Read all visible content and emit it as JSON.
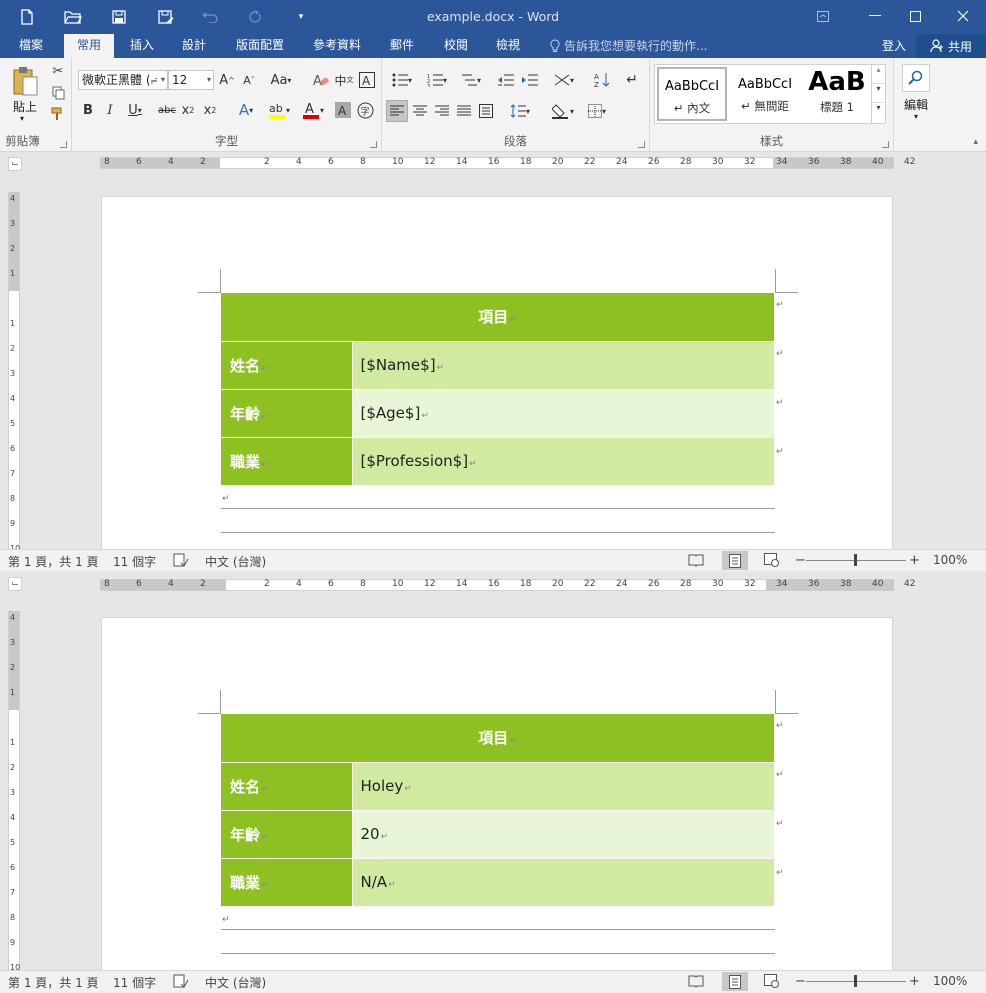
{
  "window": {
    "title": "example.docx - Word",
    "controls": [
      "ribbon-display-icon",
      "minimize-icon",
      "restore-icon",
      "close-icon"
    ]
  },
  "quick_access": [
    "new-document-icon",
    "open-folder-icon",
    "save-icon",
    "save-as-icon",
    "undo-icon",
    "redo-icon",
    "customize-icon"
  ],
  "tabs": {
    "file": "檔案",
    "items": [
      "常用",
      "插入",
      "設計",
      "版面配置",
      "參考資料",
      "郵件",
      "校閱",
      "檢視"
    ],
    "active": "常用",
    "tell_me": "告訴我您想要執行的動作...",
    "sign_in": "登入",
    "share": "共用"
  },
  "ribbon": {
    "clipboard": {
      "paste": "貼上",
      "label": "剪貼簿"
    },
    "font": {
      "name": "微軟正黑體 (⨬",
      "size": "12",
      "label": "字型"
    },
    "paragraph": {
      "label": "段落"
    },
    "styles": {
      "label": "樣式",
      "items": [
        {
          "sample": "AaBbCcI",
          "name": "↵ 內文"
        },
        {
          "sample": "AaBbCcI",
          "name": "↵ 無間距"
        },
        {
          "sample": "AaB",
          "name": "標題 1"
        }
      ]
    },
    "editing": {
      "label": "編輯"
    }
  },
  "panes": [
    {
      "table": {
        "header": "項目",
        "rows": [
          {
            "label": "姓名",
            "value": "[$Name$]"
          },
          {
            "label": "年齡",
            "value": "[$Age$]"
          },
          {
            "label": "職業",
            "value": "[$Profession$]"
          }
        ]
      },
      "status": {
        "page": "第 1 頁，共 1 頁",
        "words": "11 個字",
        "language": "中文 (台灣)",
        "zoom": "100%"
      }
    },
    {
      "table": {
        "header": "項目",
        "rows": [
          {
            "label": "姓名",
            "value": "Holey"
          },
          {
            "label": "年齡",
            "value": "20"
          },
          {
            "label": "職業",
            "value": "N/A"
          }
        ]
      },
      "status": {
        "page": "第 1 頁，共 1 頁",
        "words": "11 個字",
        "language": "中文 (台灣)",
        "zoom": "100%"
      }
    }
  ],
  "ruler": {
    "h_numbers": [
      "8",
      "6",
      "4",
      "2",
      "",
      "2",
      "4",
      "6",
      "8",
      "10",
      "12",
      "14",
      "16",
      "18",
      "20",
      "22",
      "24",
      "26",
      "28",
      "30",
      "32",
      "34",
      "36",
      "38",
      "40",
      "42"
    ],
    "v_numbers": [
      "4",
      "3",
      "2",
      "1",
      "",
      "1",
      "2",
      "3",
      "4",
      "5",
      "6",
      "7",
      "8",
      "9",
      "10"
    ]
  },
  "colors": {
    "title_bar": "#2b579a",
    "table_header": "#8dc021",
    "table_row_dark": "#d0eaa0",
    "table_row_light": "#e8f5d6"
  }
}
